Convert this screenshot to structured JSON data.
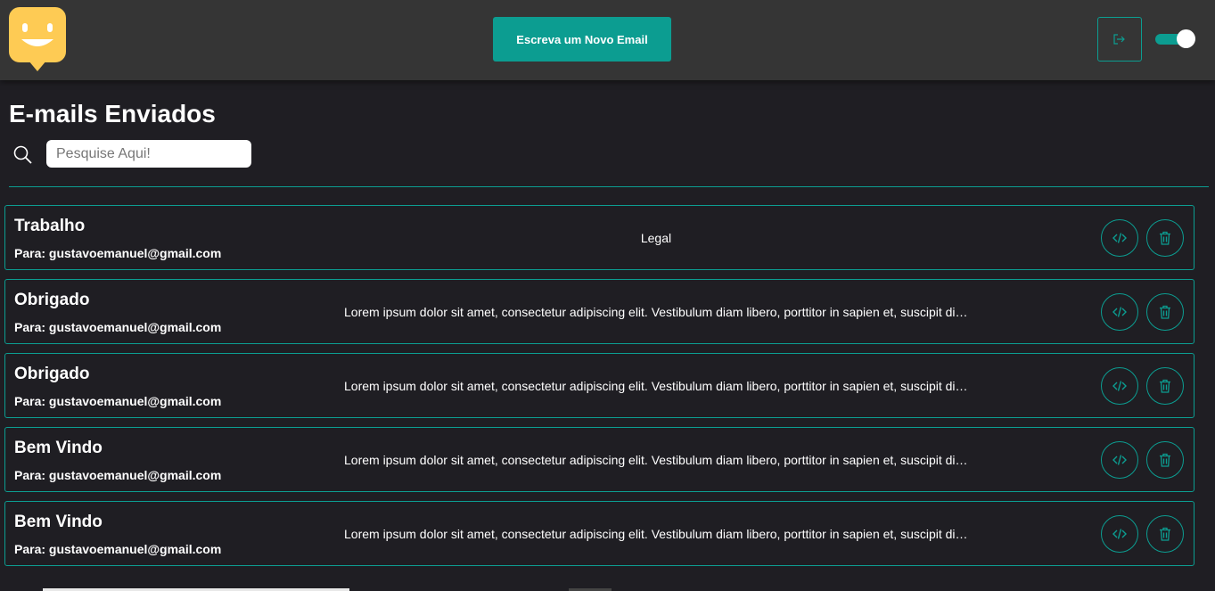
{
  "header": {
    "new_email_label": "Escreva um Novo Email",
    "logo_icon": "smiley-chat-icon",
    "logout_icon": "logout-icon",
    "theme_toggle_on": true
  },
  "page": {
    "title": "E-mails Enviados"
  },
  "search": {
    "placeholder": "Pesquise Aqui!",
    "value": "",
    "icon": "search-icon"
  },
  "emails": [
    {
      "subject": "Trabalho",
      "to": "Para: gustavoemanuel@gmail.com",
      "body": "Legal"
    },
    {
      "subject": "Obrigado",
      "to": "Para: gustavoemanuel@gmail.com",
      "body": "Lorem ipsum dolor sit amet, consectetur adipiscing elit. Vestibulum diam libero, porttitor in sapien et, suscipit dignissim"
    },
    {
      "subject": "Obrigado",
      "to": "Para: gustavoemanuel@gmail.com",
      "body": "Lorem ipsum dolor sit amet, consectetur adipiscing elit. Vestibulum diam libero, porttitor in sapien et, suscipit dignissim"
    },
    {
      "subject": "Bem Vindo",
      "to": "Para: gustavoemanuel@gmail.com",
      "body": "Lorem ipsum dolor sit amet, consectetur adipiscing elit. Vestibulum diam libero, porttitor in sapien et, suscipit dignissim"
    },
    {
      "subject": "Bem Vindo",
      "to": "Para: gustavoemanuel@gmail.com",
      "body": "Lorem ipsum dolor sit amet, consectetur adipiscing elit. Vestibulum diam libero, porttitor in sapien et, suscipit dignissim"
    }
  ],
  "colors": {
    "accent": "#0c9d91",
    "background": "#1f1e23",
    "topbar": "#353535",
    "logo": "#fecb54"
  }
}
